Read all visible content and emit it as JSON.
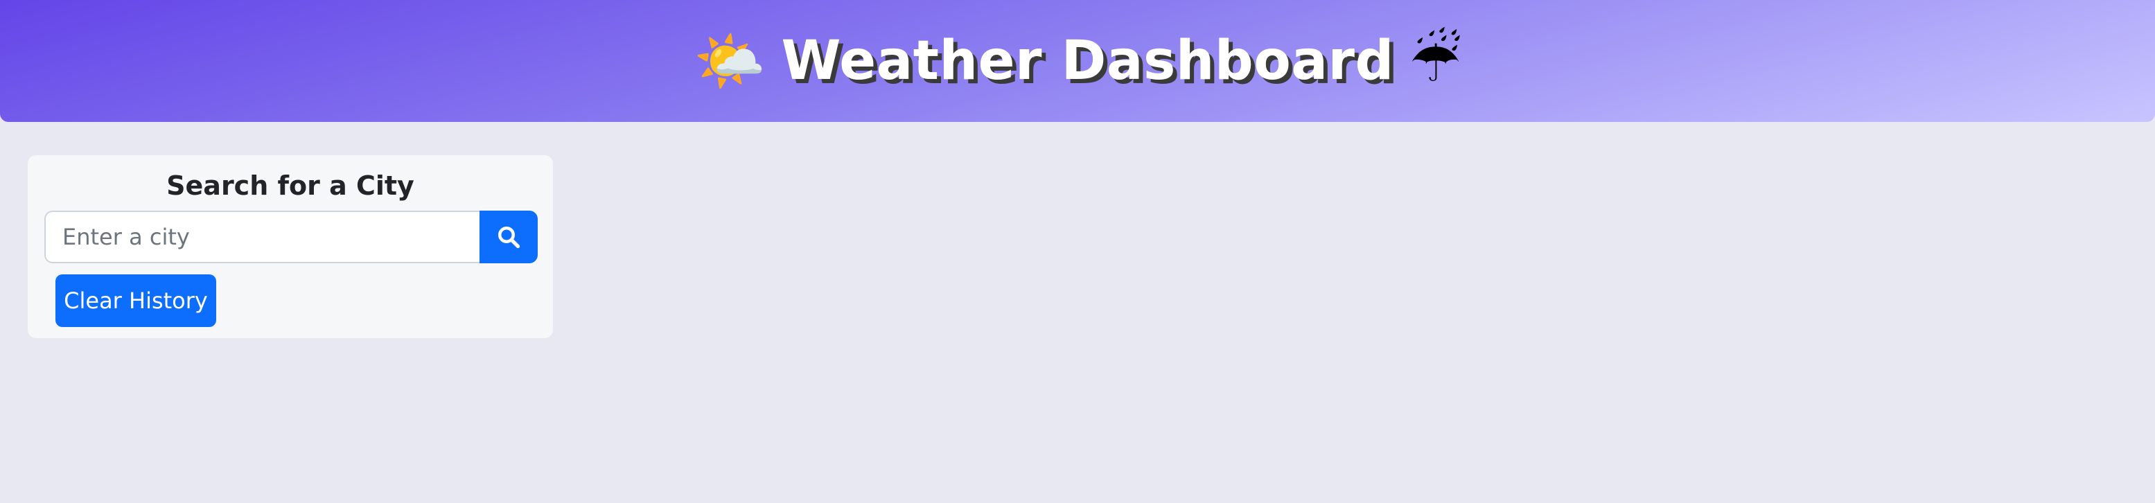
{
  "header": {
    "title": "Weather Dashboard",
    "left_emoji": "🌤️",
    "right_emoji": "☔"
  },
  "search": {
    "heading": "Search for a City",
    "placeholder": "Enter a city",
    "value": "",
    "search_icon": "search-icon",
    "clear_label": "Clear History"
  },
  "colors": {
    "header_gradient_start": "#6445e8",
    "header_gradient_end": "#c8c4ff",
    "background": "#e8e8f2",
    "card": "#f6f7f9",
    "primary": "#0d6efd"
  }
}
